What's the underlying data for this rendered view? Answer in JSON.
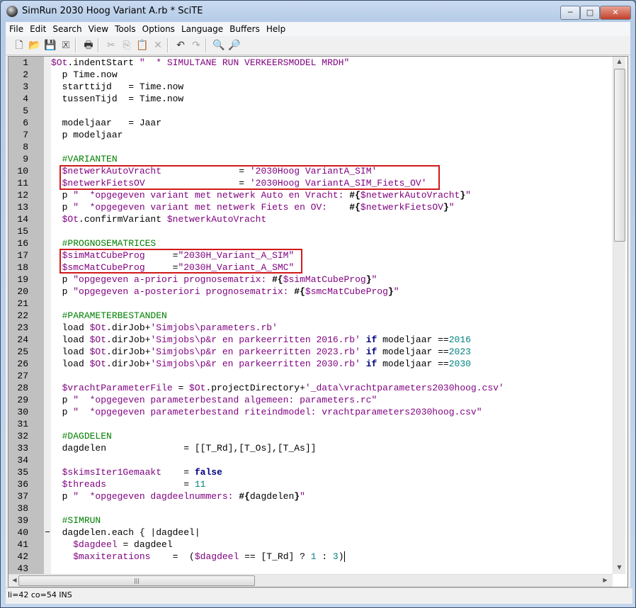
{
  "window": {
    "title": "SimRun 2030 Hoog Variant A.rb * SciTE",
    "minimize": "─",
    "maximize": "□",
    "close": "✕"
  },
  "menu": [
    "File",
    "Edit",
    "Search",
    "View",
    "Tools",
    "Options",
    "Language",
    "Buffers",
    "Help"
  ],
  "toolbar": [
    {
      "name": "new-file-icon",
      "glyph": "🗋",
      "enabled": true
    },
    {
      "name": "open-folder-icon",
      "glyph": "📂",
      "enabled": true
    },
    {
      "name": "save-icon",
      "glyph": "💾",
      "enabled": true
    },
    {
      "name": "close-file-icon",
      "glyph": "🗵",
      "enabled": true
    },
    {
      "name": "print-icon",
      "glyph": "🖶",
      "enabled": true
    },
    {
      "name": "cut-icon",
      "glyph": "✂",
      "enabled": false
    },
    {
      "name": "copy-icon",
      "glyph": "⎘",
      "enabled": false
    },
    {
      "name": "paste-icon",
      "glyph": "📋",
      "enabled": true
    },
    {
      "name": "delete-icon",
      "glyph": "✕",
      "enabled": false
    },
    {
      "name": "undo-icon",
      "glyph": "↶",
      "enabled": true
    },
    {
      "name": "redo-icon",
      "glyph": "↷",
      "enabled": false
    },
    {
      "name": "find-icon",
      "glyph": "🔍",
      "enabled": true
    },
    {
      "name": "replace-icon",
      "glyph": "🔎",
      "enabled": true
    }
  ],
  "colors": {
    "variable": "#7f007f",
    "string": "#7f007f",
    "comment": "#007f00",
    "number": "#007f7f",
    "keyword": "#00007f",
    "highlight_box": "#d21a1a"
  },
  "editor": {
    "lines": [
      [
        [
          "p",
          ""
        ],
        [
          "v",
          "$Ot"
        ],
        [
          "p",
          ".indentStart "
        ],
        [
          "s",
          "\"  * SIMULTANE RUN VERKEERSMODEL MRDH\""
        ]
      ],
      [
        [
          "p",
          "  p Time.now"
        ]
      ],
      [
        [
          "p",
          "  starttijd   = Time.now"
        ]
      ],
      [
        [
          "p",
          "  tussenTijd  = Time.now"
        ]
      ],
      [
        [
          "p",
          ""
        ]
      ],
      [
        [
          "p",
          "  modeljaar   = Jaar"
        ]
      ],
      [
        [
          "p",
          "  p modeljaar"
        ]
      ],
      [
        [
          "p",
          ""
        ]
      ],
      [
        [
          "p",
          "  "
        ],
        [
          "c",
          "#VARIANTEN"
        ]
      ],
      [
        [
          "p",
          "  "
        ],
        [
          "v",
          "$netwerkAutoVracht"
        ],
        [
          "p",
          "              = "
        ],
        [
          "s",
          "'2030Hoog VariantA_SIM'"
        ]
      ],
      [
        [
          "p",
          "  "
        ],
        [
          "v",
          "$netwerkFietsOV"
        ],
        [
          "p",
          "                 = "
        ],
        [
          "s",
          "'2030Hoog VariantA_SIM_Fiets_OV'"
        ]
      ],
      [
        [
          "p",
          "  p "
        ],
        [
          "s",
          "\"  *opgegeven variant met netwerk Auto en Vracht: "
        ],
        [
          "o",
          "#{"
        ],
        [
          "v",
          "$netwerkAutoVracht"
        ],
        [
          "o",
          "}"
        ],
        [
          "s",
          "\""
        ]
      ],
      [
        [
          "p",
          "  p "
        ],
        [
          "s",
          "\"  *opgegeven variant met netwerk Fiets en OV:    "
        ],
        [
          "o",
          "#{"
        ],
        [
          "v",
          "$netwerkFietsOV"
        ],
        [
          "o",
          "}"
        ],
        [
          "s",
          "\""
        ]
      ],
      [
        [
          "p",
          "  "
        ],
        [
          "v",
          "$Ot"
        ],
        [
          "p",
          ".confirmVariant "
        ],
        [
          "v",
          "$netwerkAutoVracht"
        ]
      ],
      [
        [
          "p",
          ""
        ]
      ],
      [
        [
          "p",
          "  "
        ],
        [
          "c",
          "#PROGNOSEMATRICES"
        ]
      ],
      [
        [
          "p",
          "  "
        ],
        [
          "v",
          "$simMatCubeProg"
        ],
        [
          "p",
          "     ="
        ],
        [
          "s",
          "\"2030H_Variant_A_SIM\""
        ]
      ],
      [
        [
          "p",
          "  "
        ],
        [
          "v",
          "$smcMatCubeProg"
        ],
        [
          "p",
          "     ="
        ],
        [
          "s",
          "\"2030H_Variant_A_SMC\""
        ]
      ],
      [
        [
          "p",
          "  p "
        ],
        [
          "s",
          "\"opgegeven a-priori prognosematrix: "
        ],
        [
          "o",
          "#{"
        ],
        [
          "v",
          "$simMatCubeProg"
        ],
        [
          "o",
          "}"
        ],
        [
          "s",
          "\""
        ]
      ],
      [
        [
          "p",
          "  p "
        ],
        [
          "s",
          "\"opgegeven a-posteriori prognosematrix: "
        ],
        [
          "o",
          "#{"
        ],
        [
          "v",
          "$smcMatCubeProg"
        ],
        [
          "o",
          "}"
        ],
        [
          "s",
          "\""
        ]
      ],
      [
        [
          "p",
          ""
        ]
      ],
      [
        [
          "p",
          "  "
        ],
        [
          "c",
          "#PARAMETERBESTANDEN"
        ]
      ],
      [
        [
          "p",
          "  load "
        ],
        [
          "v",
          "$Ot"
        ],
        [
          "p",
          ".dirJob+"
        ],
        [
          "s",
          "'Simjobs\\parameters.rb'"
        ]
      ],
      [
        [
          "p",
          "  load "
        ],
        [
          "v",
          "$Ot"
        ],
        [
          "p",
          ".dirJob+"
        ],
        [
          "s",
          "'Simjobs\\p&r en parkeerritten 2016.rb'"
        ],
        [
          "p",
          " "
        ],
        [
          "k",
          "if"
        ],
        [
          "p",
          " modeljaar =="
        ],
        [
          "n",
          "2016"
        ]
      ],
      [
        [
          "p",
          "  load "
        ],
        [
          "v",
          "$Ot"
        ],
        [
          "p",
          ".dirJob+"
        ],
        [
          "s",
          "'Simjobs\\p&r en parkeerritten 2023.rb'"
        ],
        [
          "p",
          " "
        ],
        [
          "k",
          "if"
        ],
        [
          "p",
          " modeljaar =="
        ],
        [
          "n",
          "2023"
        ]
      ],
      [
        [
          "p",
          "  load "
        ],
        [
          "v",
          "$Ot"
        ],
        [
          "p",
          ".dirJob+"
        ],
        [
          "s",
          "'Simjobs\\p&r en parkeerritten 2030.rb'"
        ],
        [
          "p",
          " "
        ],
        [
          "k",
          "if"
        ],
        [
          "p",
          " modeljaar =="
        ],
        [
          "n",
          "2030"
        ]
      ],
      [
        [
          "p",
          ""
        ]
      ],
      [
        [
          "p",
          "  "
        ],
        [
          "v",
          "$vrachtParameterFile"
        ],
        [
          "p",
          " = "
        ],
        [
          "v",
          "$Ot"
        ],
        [
          "p",
          ".projectDirectory+"
        ],
        [
          "s",
          "'_data\\vrachtparameters2030hoog.csv'"
        ]
      ],
      [
        [
          "p",
          "  p "
        ],
        [
          "s",
          "\"  *opgegeven parameterbestand algemeen: parameters.rc\""
        ]
      ],
      [
        [
          "p",
          "  p "
        ],
        [
          "s",
          "\"  *opgegeven parameterbestand riteindmodel: vrachtparameters2030hoog.csv\""
        ]
      ],
      [
        [
          "p",
          ""
        ]
      ],
      [
        [
          "p",
          "  "
        ],
        [
          "c",
          "#DAGDELEN"
        ]
      ],
      [
        [
          "p",
          "  dagdelen              = [[T_Rd],[T_Os],[T_As]]"
        ]
      ],
      [
        [
          "p",
          ""
        ]
      ],
      [
        [
          "p",
          "  "
        ],
        [
          "v",
          "$skimsIter1Gemaakt"
        ],
        [
          "p",
          "    = "
        ],
        [
          "k",
          "false"
        ]
      ],
      [
        [
          "p",
          "  "
        ],
        [
          "v",
          "$threads"
        ],
        [
          "p",
          "              = "
        ],
        [
          "n",
          "11"
        ]
      ],
      [
        [
          "p",
          "  p "
        ],
        [
          "s",
          "\"  *opgegeven dagdeelnummers: "
        ],
        [
          "o",
          "#{"
        ],
        [
          "p",
          "dagdelen"
        ],
        [
          "o",
          "}"
        ],
        [
          "s",
          "\""
        ]
      ],
      [
        [
          "p",
          ""
        ]
      ],
      [
        [
          "p",
          "  "
        ],
        [
          "c",
          "#SIMRUN"
        ]
      ],
      [
        [
          "p",
          "  dagdelen.each { |dagdeel|"
        ]
      ],
      [
        [
          "p",
          "    "
        ],
        [
          "v",
          "$dagdeel"
        ],
        [
          "p",
          " = dagdeel"
        ]
      ],
      [
        [
          "p",
          "    "
        ],
        [
          "v",
          "$maxiterations"
        ],
        [
          "p",
          "    =  ("
        ],
        [
          "v",
          "$dagdeel"
        ],
        [
          "p",
          " == [T_Rd] ? "
        ],
        [
          "n",
          "1"
        ],
        [
          "p",
          " : "
        ],
        [
          "n",
          "3"
        ],
        [
          "p",
          ")"
        ]
      ],
      [
        [
          "p",
          ""
        ]
      ]
    ],
    "fold_marker_line": 40,
    "fold_marker": "−",
    "caret_line": 42
  },
  "status": "li=42 co=54 INS"
}
